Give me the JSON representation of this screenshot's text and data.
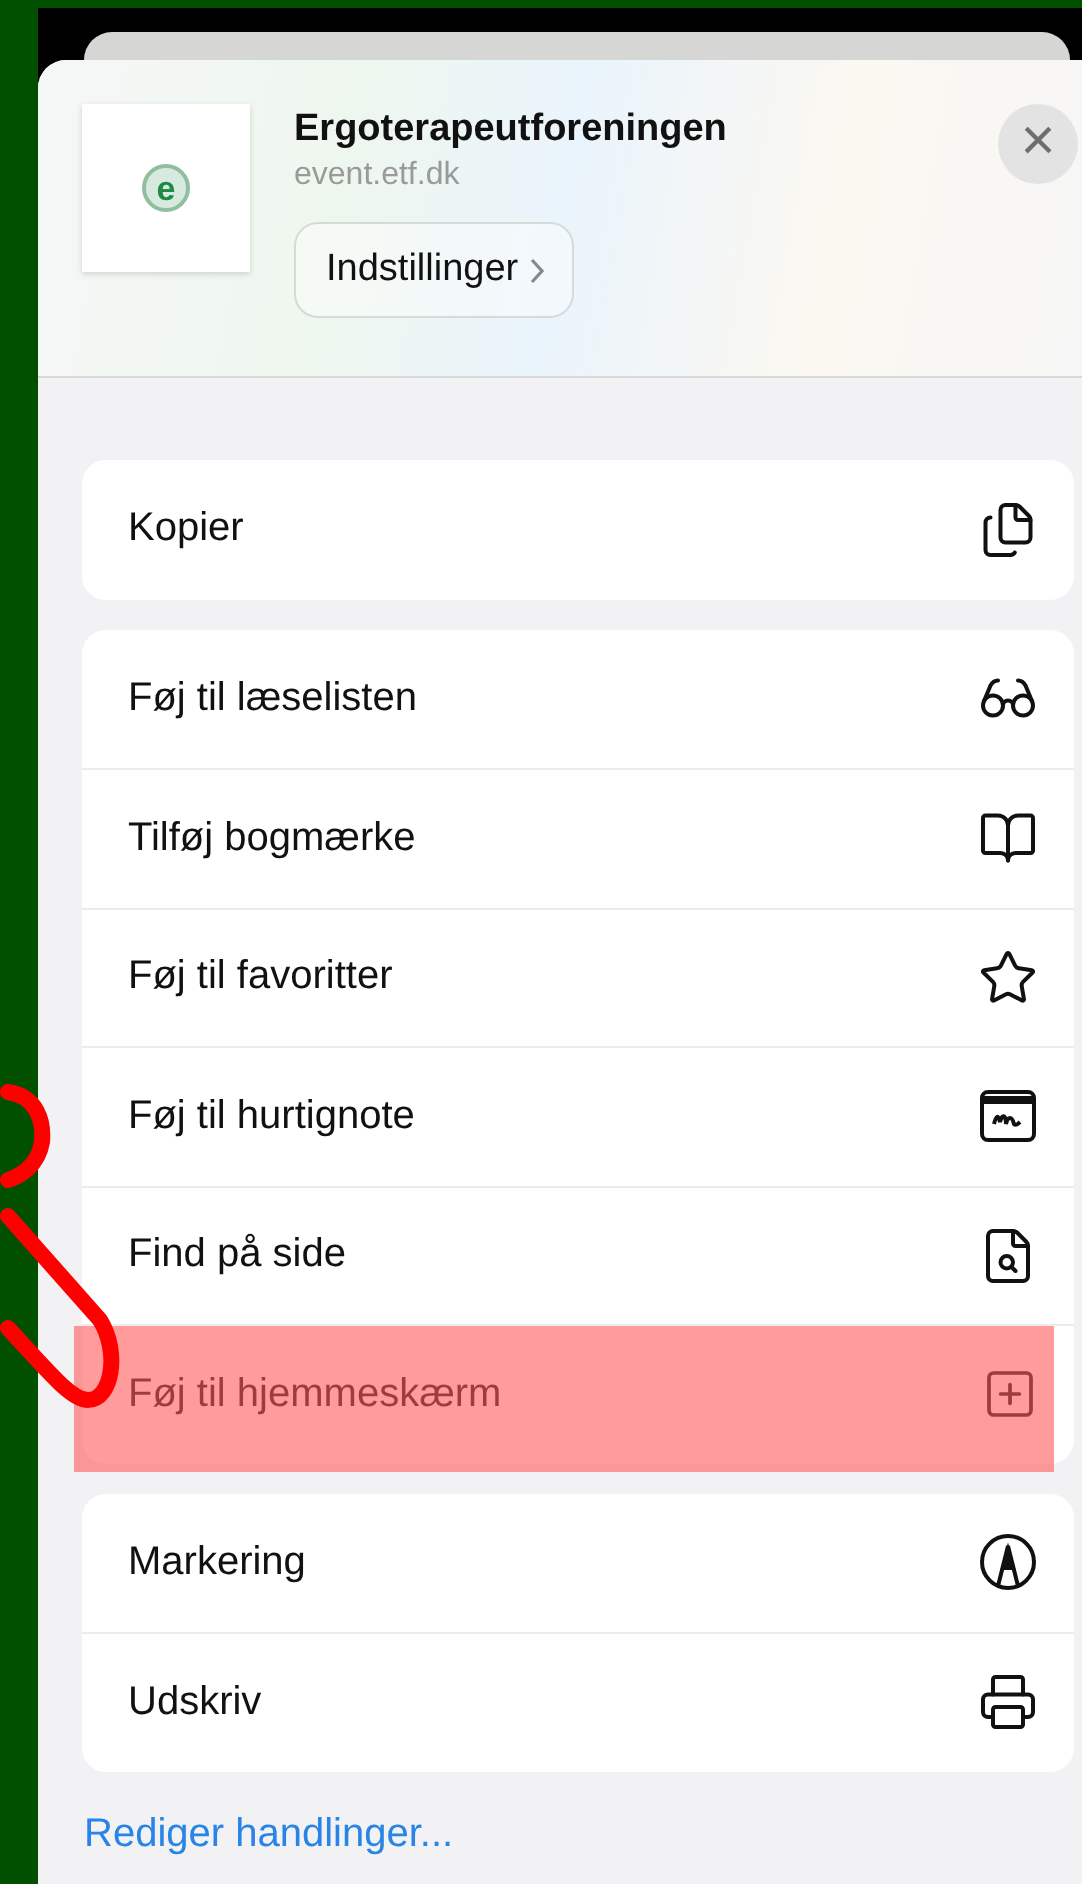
{
  "header": {
    "title": "Ergoterapeutforeningen",
    "subtitle": "event.etf.dk",
    "logo_letter": "e",
    "settings_button": "Indstillinger",
    "close": "×"
  },
  "groups": [
    {
      "items": [
        {
          "label": "Kopier",
          "highlighted": false
        }
      ]
    },
    {
      "items": [
        {
          "label": "Føj til læselisten",
          "highlighted": false
        },
        {
          "label": "Tilføj bogmærke",
          "highlighted": false
        },
        {
          "label": "Føj til favoritter",
          "highlighted": false
        },
        {
          "label": "Føj til hurtignote",
          "highlighted": false
        },
        {
          "label": "Find på side",
          "highlighted": false
        },
        {
          "label": "Føj til hjemmeskærm",
          "highlighted": true
        }
      ]
    },
    {
      "items": [
        {
          "label": "Markering",
          "highlighted": false
        },
        {
          "label": "Udskriv",
          "highlighted": false
        }
      ]
    }
  ],
  "edit_link": "Rediger handlinger..."
}
